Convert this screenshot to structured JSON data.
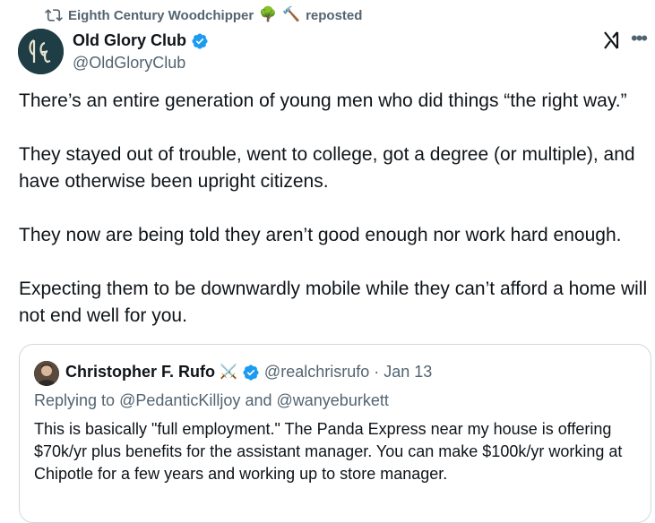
{
  "repost": {
    "icon": "repost-icon",
    "user": "Eighth Century Woodchipper",
    "emojis": [
      "🌳",
      "🔨"
    ],
    "label": "reposted"
  },
  "author": {
    "name": "Old Glory Club",
    "handle": "@OldGloryClub",
    "verified": true,
    "avatar_monogram": "OGC"
  },
  "tweet": {
    "paragraphs": [
      "There’s an entire generation of young men who did things “the right way.”",
      "They stayed out of trouble, went to college, got a degree (or multiple), and have otherwise been upright citizens.",
      "They now are being told they aren’t good enough nor work hard enough.",
      "Expecting them to be downwardly mobile while they can’t afford a home will not end well for you."
    ]
  },
  "quote": {
    "name": "Christopher F. Rufo",
    "name_emoji": "⚔️",
    "verified": true,
    "handle": "@realchrisrufo",
    "separator": "·",
    "date": "Jan 13",
    "reply_prefix": "Replying to",
    "reply_to_1": "@PedanticKilljoy",
    "reply_joiner": "and",
    "reply_to_2": "@wanyeburkett",
    "text": "This is basically \"full employment.\" The Panda Express near my house is offering $70k/yr plus benefits for the assistant manager. You can make $100k/yr working at Chipotle for a few years and working up to store manager."
  },
  "icons": {
    "grok": "grok-icon",
    "more": "more-icon",
    "verified": "verified-badge-icon"
  },
  "colors": {
    "verified": "#1d9bf0",
    "secondary_text": "#536471",
    "border": "#cfd9de"
  }
}
